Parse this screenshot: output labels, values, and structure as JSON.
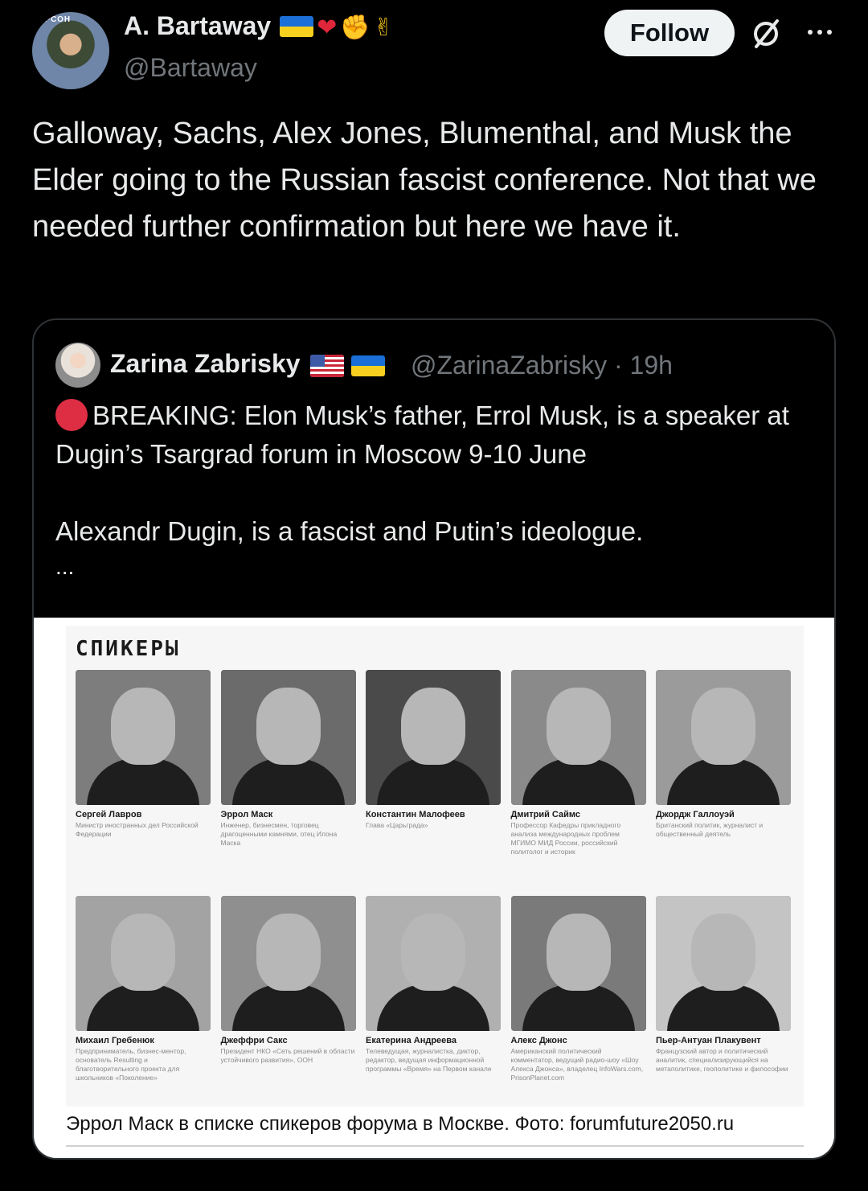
{
  "author": {
    "name": "A. Bartaway",
    "handle": "@Bartaway",
    "avatar_sign": "ЕРСОН"
  },
  "actions": {
    "follow_label": "Follow"
  },
  "tweet": {
    "text": "Galloway, Sachs, Alex Jones, Blumenthal, and Musk the Elder going to the Russian fascist conference. Not that we needed further confirmation but here we have it."
  },
  "quote": {
    "author_name": "Zarina Zabrisky",
    "handle": "@ZarinaZabrisky",
    "time": "19h",
    "meta": "@ZarinaZabrisky · 19h",
    "line1": "BREAKING: Elon Musk’s father, Errol Musk, is a speaker at Dugin’s Tsargrad forum in Moscow 9-10 June",
    "line2": "Alexandr Dugin, is a fascist and Putin’s ideologue.",
    "ellipsis": "..."
  },
  "image": {
    "heading": "СПИКЕРЫ",
    "caption": "Эррол Маск в списке спикеров форума в Москве. Фото: forumfuture2050.ru",
    "speakers": [
      {
        "name": "Сергей Лавров",
        "role": "Министр иностранных дел Российской Федерации"
      },
      {
        "name": "Эррол Маск",
        "role": "Инженер, бизнесмен, торговец драгоценными камнями, отец Илона Маска"
      },
      {
        "name": "Константин Малофеев",
        "role": "Глава «Царьграда»"
      },
      {
        "name": "Дмитрий Саймс",
        "role": "Профессор Кафедры прикладного анализа международных проблем МГИМО МИД России, российский политолог и историк"
      },
      {
        "name": "Джордж Галлоуэй",
        "role": "Британский политик, журналист и общественный деятель"
      },
      {
        "name": "Михаил Гребенюк",
        "role": "Предприниматель, бизнес-ментор, основатель Resulting и благотворительного проекта для школьников «Поколение»"
      },
      {
        "name": "Джеффри Сакс",
        "role": "Президент НКО «Сеть решений в области устойчивого развития», ООН"
      },
      {
        "name": "Екатерина Андреева",
        "role": "Телеведущая, журналистка, диктор, редактор, ведущая информационной программы «Время» на Первом канале"
      },
      {
        "name": "Алекс Джонс",
        "role": "Американский политический комментатор, ведущий радио-шоу «Шоу Алекса Джонса», владелец InfoWars.com, PrisonPlanet.com"
      },
      {
        "name": "Пьер-Антуан Плакувент",
        "role": "Французский автор и политический аналитик, специализирующийся на метаполитике, геополитике и философии"
      }
    ]
  },
  "colors": {
    "background": "#000000",
    "text": "#e7e9ea",
    "muted": "#71767b",
    "border": "#2f3336",
    "breaking_dot": "#dd2e44"
  }
}
